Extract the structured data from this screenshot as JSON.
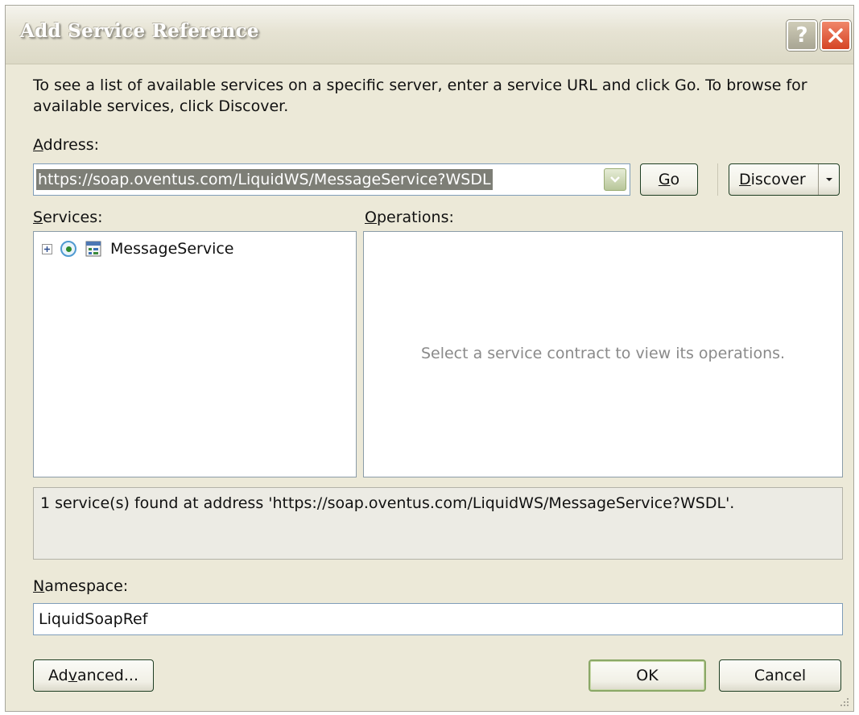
{
  "window": {
    "title": "Add Service Reference",
    "help_label": "?"
  },
  "instructions": "To see a list of available services on a specific server, enter a service URL and click Go. To browse for available services, click Discover.",
  "address": {
    "label_hotkey": "A",
    "label_rest": "ddress:",
    "value": "https://soap.oventus.com/LiquidWS/MessageService?WSDL"
  },
  "buttons": {
    "go_hotkey": "G",
    "go_rest": "o",
    "discover_hotkey": "D",
    "discover_rest": "iscover",
    "advanced_pre": "Ad",
    "advanced_hotkey": "v",
    "advanced_post": "anced...",
    "ok": "OK",
    "cancel": "Cancel"
  },
  "services": {
    "label_hotkey": "S",
    "label_rest": "ervices:",
    "items": [
      {
        "name": "MessageService",
        "icon": "service-icon",
        "expanded": false,
        "selected": true
      }
    ]
  },
  "operations": {
    "label_hotkey": "O",
    "label_rest": "perations:",
    "placeholder": "Select a service contract to view its operations."
  },
  "status": "1 service(s) found at address 'https://soap.oventus.com/LiquidWS/MessageService?WSDL'.",
  "namespace": {
    "label_hotkey": "N",
    "label_rest": "amespace:",
    "value": "LiquidSoapRef"
  },
  "colors": {
    "dialog_bg": "#ece9d8",
    "close_button": "#d54425",
    "default_button_border": "#8aa867",
    "selection_bg": "#7d7e76"
  }
}
